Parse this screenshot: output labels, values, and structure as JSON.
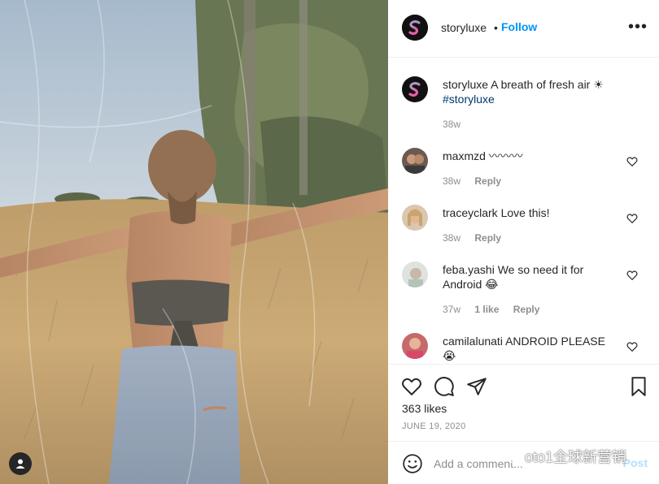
{
  "post": {
    "username": "storyluxe",
    "separator": "•",
    "follow_label": "Follow",
    "more_label": "•••",
    "caption": {
      "username": "storyluxe",
      "text": "A breath of fresh air ☀",
      "hashtag": "#storyluxe",
      "age": "38w"
    },
    "comments": [
      {
        "username": "maxmzd",
        "text": "〰〰〰",
        "age": "38w",
        "likes": "",
        "reply_label": "Reply"
      },
      {
        "username": "traceyclark",
        "text": "Love this!",
        "age": "38w",
        "likes": "",
        "reply_label": "Reply"
      },
      {
        "username": "feba.yashi",
        "text": "We so need it for Android 😂",
        "age": "37w",
        "likes": "1 like",
        "reply_label": "Reply"
      },
      {
        "username": "camilalunati",
        "text": "ANDROID PLEASE 😭",
        "age": "",
        "likes": "",
        "reply_label": ""
      }
    ],
    "likes_count": "363 likes",
    "date": "JUNE 19, 2020",
    "add_comment_placeholder": "Add a comment...",
    "post_label": "Post"
  },
  "watermark": {
    "text": "oto1全球新营销"
  },
  "icons": {
    "header_avatar": "storyluxe-logo-icon",
    "heart": "heart-icon",
    "comment": "comment-icon",
    "share": "paper-plane-icon",
    "save": "bookmark-icon",
    "emoji": "smiley-icon",
    "tag": "user-tag-icon"
  },
  "colors": {
    "follow": "#0095f6",
    "hashtag": "#00376b",
    "secondary_text": "#8e8e8e",
    "divider": "#efefef",
    "post_disabled": "#b2dffc"
  }
}
